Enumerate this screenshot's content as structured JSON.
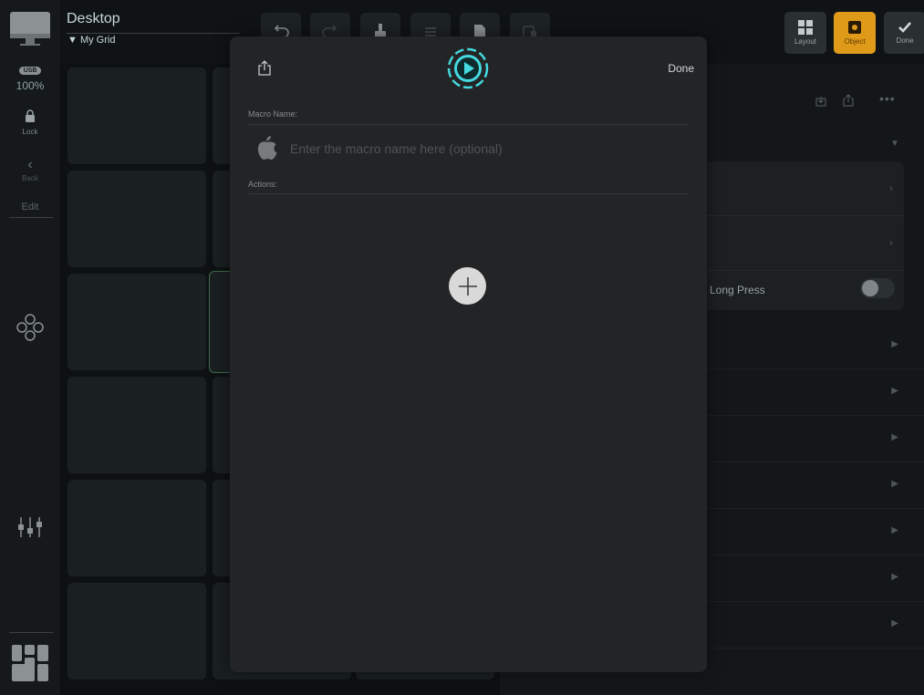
{
  "header": {
    "title": "Desktop",
    "grid_selector": "▼ My Grid",
    "layout_label": "Layout",
    "object_label": "Object",
    "done_label": "Done"
  },
  "rail": {
    "connection_label": "USB",
    "zoom_value": "100%",
    "lock_label": "Lock",
    "back_label": "Back",
    "edit_label": "Edit"
  },
  "inspector": {
    "long_press_label": "Long Press",
    "long_press_enabled": false
  },
  "modal": {
    "done_label": "Done",
    "macro_name_label": "Macro Name:",
    "macro_name_placeholder": "Enter the macro name here (optional)",
    "macro_name_value": "",
    "actions_label": "Actions:"
  },
  "colors": {
    "accent_cyan": "#45d9e0",
    "object_active": "#e09a1a",
    "modal_bg": "#232425"
  }
}
